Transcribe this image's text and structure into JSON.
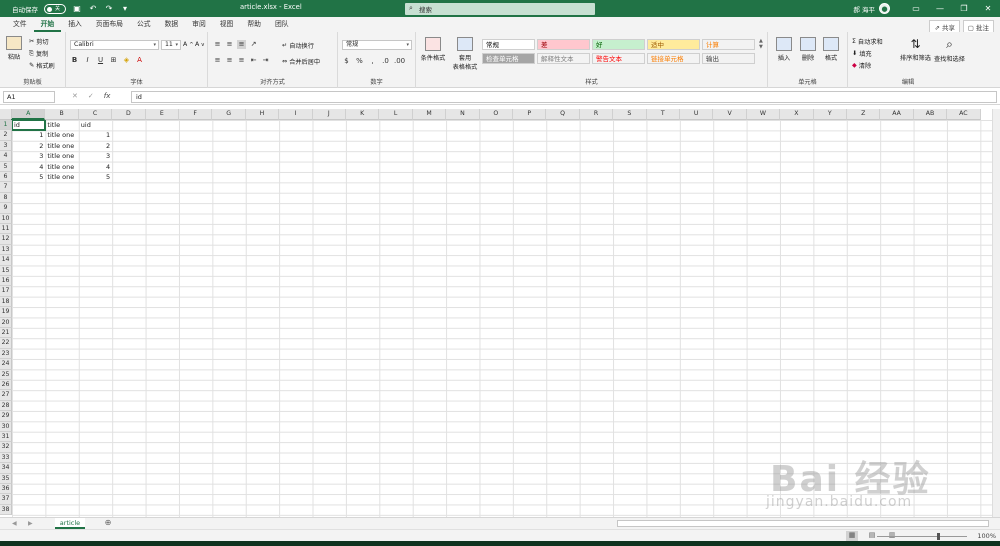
{
  "titlebar": {
    "autosave_label": "自动保存",
    "autosave_state": "关",
    "doc_title": "article.xlsx  -  Excel",
    "search_placeholder": "搜索",
    "user_name": "郝 海平"
  },
  "tabs": [
    "文件",
    "开始",
    "插入",
    "页面布局",
    "公式",
    "数据",
    "审阅",
    "视图",
    "帮助",
    "团队"
  ],
  "active_tab": "开始",
  "share_label": "共享",
  "comment_label": "批注",
  "ribbon": {
    "clipboard": {
      "label": "剪贴板",
      "paste": "粘贴",
      "cut": "剪切",
      "copy": "复制",
      "format_painter": "格式刷"
    },
    "font": {
      "label": "字体",
      "name": "Calibri",
      "size": "11"
    },
    "alignment": {
      "label": "对齐方式",
      "wrap": "自动换行",
      "merge": "合并后居中"
    },
    "number": {
      "label": "数字",
      "format": "常规"
    },
    "styles": {
      "label": "样式",
      "conditional": "条件格式",
      "table": "套用\n表格格式",
      "cells": [
        {
          "text": "常规",
          "bg": "#ffffff",
          "fg": "#000000"
        },
        {
          "text": "差",
          "bg": "#ffc7ce",
          "fg": "#9c0006"
        },
        {
          "text": "好",
          "bg": "#c6efce",
          "fg": "#006100"
        },
        {
          "text": "适中",
          "bg": "#ffeb9c",
          "fg": "#9c5700"
        },
        {
          "text": "计算",
          "bg": "#f2f2f2",
          "fg": "#fa7d00"
        },
        {
          "text": "检查单元格",
          "bg": "#a5a5a5",
          "fg": "#ffffff"
        },
        {
          "text": "解释性文本",
          "bg": "#f3f3f3",
          "fg": "#7f7f7f"
        },
        {
          "text": "警告文本",
          "bg": "#f3f3f3",
          "fg": "#ff0000"
        },
        {
          "text": "链接单元格",
          "bg": "#f3f3f3",
          "fg": "#fa7d00"
        },
        {
          "text": "输出",
          "bg": "#f2f2f2",
          "fg": "#3f3f3f"
        }
      ]
    },
    "cells_group": {
      "label": "单元格",
      "insert": "插入",
      "delete": "删除",
      "format": "格式"
    },
    "editing": {
      "label": "编辑",
      "autosum": "自动求和",
      "fill": "填充",
      "clear": "清除",
      "sort": "排序和筛选",
      "find": "查找和选择"
    }
  },
  "formula": {
    "name_box": "A1",
    "content": "id"
  },
  "columns": [
    "A",
    "B",
    "C",
    "D",
    "E",
    "F",
    "G",
    "H",
    "I",
    "J",
    "K",
    "L",
    "M",
    "N",
    "O",
    "P",
    "Q",
    "R",
    "S",
    "T",
    "U",
    "V",
    "W",
    "X",
    "Y",
    "Z",
    "AA",
    "AB",
    "AC"
  ],
  "rows": [
    "1",
    "2",
    "3",
    "4",
    "5",
    "6",
    "7",
    "8",
    "9",
    "10",
    "11",
    "12",
    "13",
    "14",
    "15",
    "16",
    "17",
    "18",
    "19",
    "20",
    "21",
    "22",
    "23",
    "24",
    "25",
    "26",
    "27",
    "28",
    "29",
    "30",
    "31",
    "32",
    "33",
    "34",
    "35",
    "36",
    "37",
    "38"
  ],
  "table": {
    "headers": [
      "id",
      "title",
      "uid"
    ],
    "rows": [
      [
        "1",
        "title one",
        "1"
      ],
      [
        "2",
        "title one",
        "2"
      ],
      [
        "3",
        "title one",
        "3"
      ],
      [
        "4",
        "title one",
        "4"
      ],
      [
        "5",
        "title one",
        "5"
      ]
    ]
  },
  "sheet_tab": "article",
  "zoom": "100%",
  "watermark": {
    "big": "Bai 经验",
    "small": "jingyan.baidu.com"
  },
  "colors": {
    "accent": "#217346"
  }
}
